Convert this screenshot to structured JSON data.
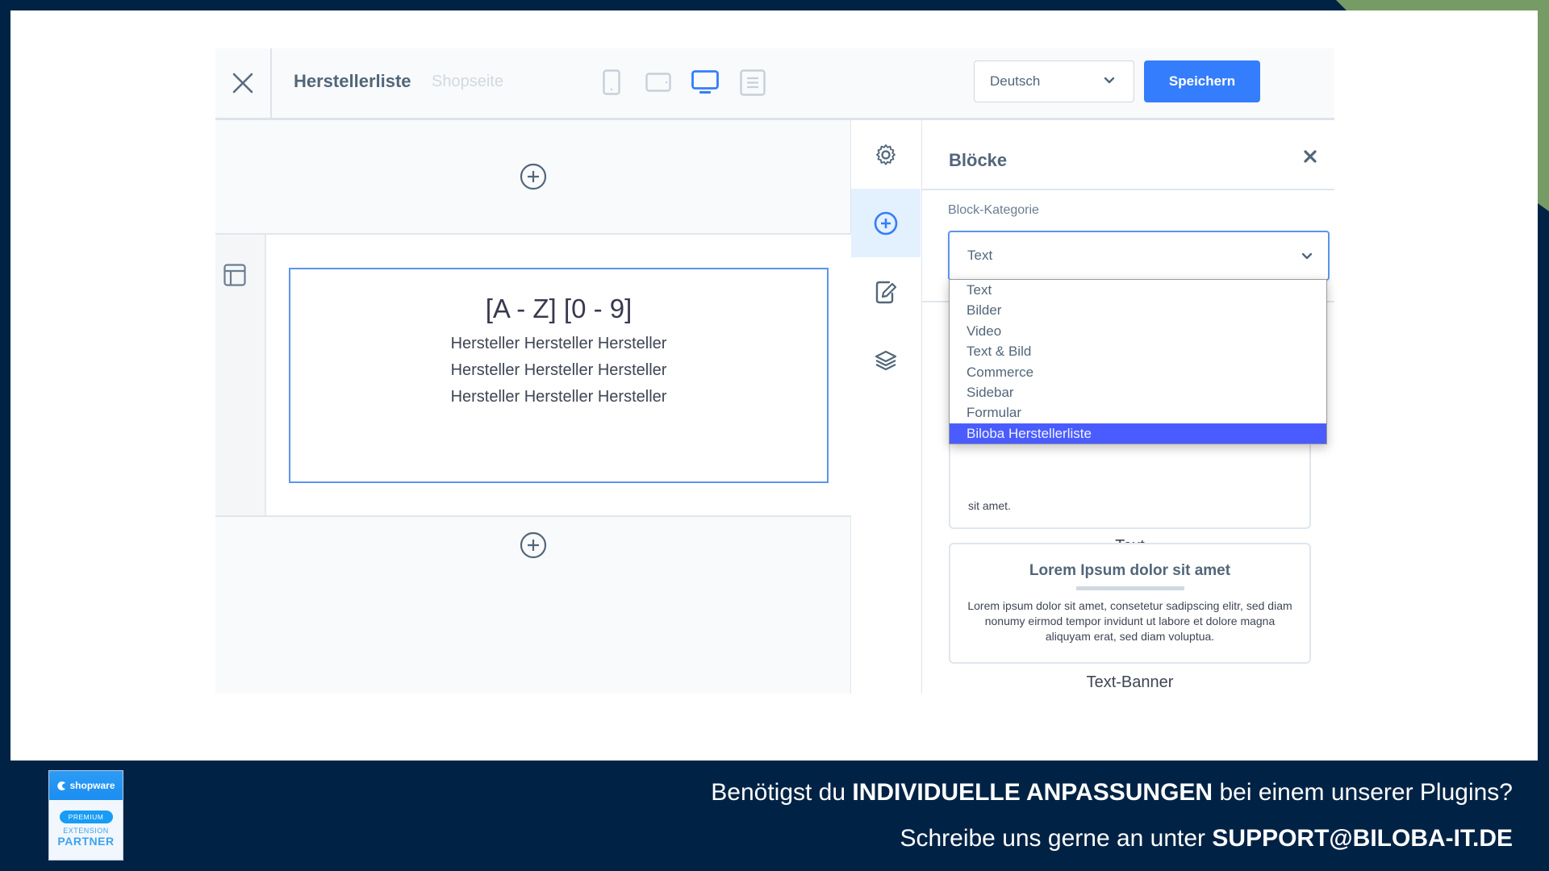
{
  "colors": {
    "background": "#002345",
    "accent_green": "#769b65",
    "primary_blue": "#347dfc",
    "dropdown_highlight": "#4a5cff"
  },
  "toolbar": {
    "close_icon": "close-icon",
    "title": "Herstellerliste",
    "subtitle": "Shopseite",
    "devices": [
      {
        "name": "mobile",
        "icon": "mobile-icon",
        "active": false
      },
      {
        "name": "tablet",
        "icon": "tablet-icon",
        "active": false
      },
      {
        "name": "desktop",
        "icon": "desktop-icon",
        "active": true
      },
      {
        "name": "form",
        "icon": "form-view-icon",
        "active": false
      }
    ],
    "language": "Deutsch",
    "save_label": "Speichern"
  },
  "canvas": {
    "block": {
      "heading": "[A - Z] [0 - 9]",
      "lines": [
        "Hersteller Hersteller Hersteller",
        "Hersteller Hersteller Hersteller",
        "Hersteller Hersteller Hersteller"
      ]
    }
  },
  "sidebar": {
    "items": [
      {
        "icon": "settings-icon",
        "active": false
      },
      {
        "icon": "add-block-icon",
        "active": true
      },
      {
        "icon": "edit-icon",
        "active": false
      },
      {
        "icon": "layers-icon",
        "active": false
      }
    ]
  },
  "panel": {
    "title": "Blöcke",
    "category_label": "Block-Kategorie",
    "category_value": "Text",
    "dropdown_options": [
      "Text",
      "Bilder",
      "Video",
      "Text & Bild",
      "Commerce",
      "Sidebar",
      "Formular",
      "Biloba Herstellerliste"
    ],
    "selected_option": "Biloba Herstellerliste",
    "cards": [
      {
        "caption": "Text",
        "visible_text": "sit amet."
      },
      {
        "caption": "Text-Banner",
        "title": "Lorem Ipsum dolor sit amet",
        "text": "Lorem ipsum dolor sit amet, consetetur sadipscing elitr, sed diam nonumy eirmod tempor invidunt ut labore et dolore magna aliquyam erat, sed diam voluptua."
      }
    ]
  },
  "footer": {
    "badge": {
      "brand": "shopware",
      "tier": "PREMIUM",
      "line1": "EXTENSION",
      "line2": "PARTNER"
    },
    "promo_line1_pre": "Benötigst du ",
    "promo_line1_bold": "INDIVIDUELLE ANPASSUNGEN",
    "promo_line1_post": " bei einem unserer Plugins?",
    "promo_line2_pre": "Schreibe uns gerne an unter ",
    "promo_line2_bold": "SUPPORT@BILOBA-IT.DE"
  }
}
